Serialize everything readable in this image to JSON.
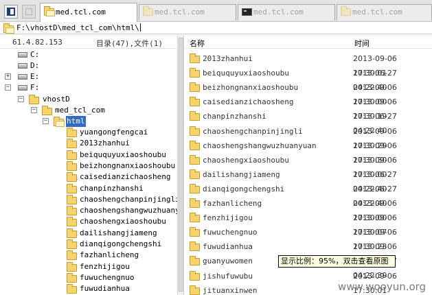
{
  "tabs": [
    {
      "label": "med.tcl.com",
      "icon": "folder-icon",
      "active": true
    },
    {
      "label": "med.tcl.com",
      "icon": "folder-icon",
      "active": false
    },
    {
      "label": "med.tcl.com",
      "icon": "terminal-icon",
      "active": false
    },
    {
      "label": "med.tcl.com",
      "icon": "folder-icon",
      "active": false
    }
  ],
  "address": {
    "path": "F:\\vhostD\\med_tcl_com\\html\\"
  },
  "info": {
    "ip": "61.4.82.153",
    "count": "目录(47),文件(1)"
  },
  "tree": {
    "drives": [
      "C:",
      "D:",
      "E:",
      "F:"
    ],
    "vhost": "vhostD",
    "site": "med_tcl_com",
    "selected": "html",
    "children": [
      "yuangongfengcai",
      "2013zhanhui",
      "beiququyuxiaoshoubu",
      "beizhongnanxiaoshoubu",
      "caisedianzichaosheng",
      "chanpinzhanshi",
      "chaoshengchanpinjingli",
      "chaoshengshangwuzhuanyuan",
      "chaoshengxiaoshoubu",
      "dailishangjiameng",
      "dianqigongchengshi",
      "fazhanlicheng",
      "fenzhijigou",
      "fuwuchengnuo",
      "fuwudianhua"
    ]
  },
  "columns": {
    "name": "名称",
    "time": "时间"
  },
  "files": [
    {
      "name": "2013zhanhui",
      "time": "2013-09-06 17:30:01"
    },
    {
      "name": "beiququyuxiaoshoubu",
      "time": "2013-06-27 04:22:40"
    },
    {
      "name": "beizhongnanxiaoshoubu",
      "time": "2013-09-06 17:30:00"
    },
    {
      "name": "caisedianzichaosheng",
      "time": "2013-09-06 17:30:19"
    },
    {
      "name": "chanpinzhanshi",
      "time": "2013-06-27 04:22:40"
    },
    {
      "name": "chaoshengchanpinjingli",
      "time": "2013-09-06 17:30:29"
    },
    {
      "name": "chaoshengshangwuzhuanyuan",
      "time": "2013-09-06 17:30:30"
    },
    {
      "name": "chaoshengxiaoshoubu",
      "time": "2013-09-06 17:30:00"
    },
    {
      "name": "dailishangjiameng",
      "time": "2013-06-27 04:22:40"
    },
    {
      "name": "dianqigongchengshi",
      "time": "2013-06-27 04:22:40"
    },
    {
      "name": "fazhanlicheng",
      "time": "2013-09-06 17:30:00"
    },
    {
      "name": "fenzhijigou",
      "time": "2013-09-06 17:30:07"
    },
    {
      "name": "fuwuchengnuo",
      "time": "2013-09-06 17:30:23"
    },
    {
      "name": "fuwudianhua",
      "time": "2013-09-06 17:30:09"
    },
    {
      "name": "guanyuwomen",
      "time": "2013-06-27 04:22:39"
    },
    {
      "name": "jishufuwubu",
      "time": "2013-09-06 17:30:01"
    },
    {
      "name": "jituanxinwen",
      "time": ""
    }
  ],
  "tooltip": "显示比例：95%，双击查看原图",
  "watermark": "www.wooyun.org"
}
